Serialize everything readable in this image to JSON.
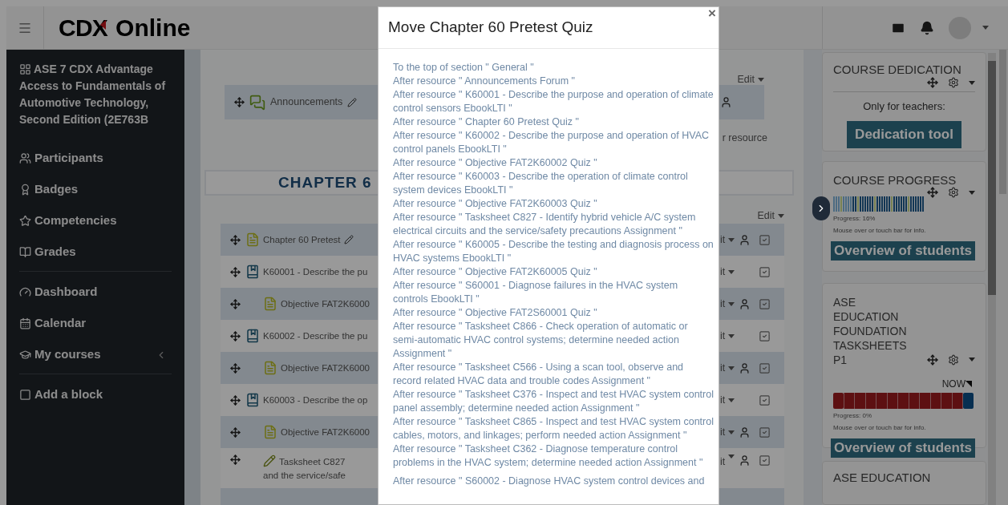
{
  "header": {
    "logo_main": "CDX",
    "logo_rest": "Online"
  },
  "sidebar": {
    "course_title": "ASE 7 CDX Advantage Access to Fundamentals of Automotive Technology, Second Edition (2E763B",
    "groups": [
      [
        {
          "label": "Participants",
          "chevron": false
        },
        {
          "label": "Badges",
          "chevron": false
        },
        {
          "label": "Competencies",
          "chevron": false
        },
        {
          "label": "Grades",
          "chevron": false
        }
      ],
      [
        {
          "label": "Dashboard",
          "chevron": false
        },
        {
          "label": "Calendar",
          "chevron": false
        },
        {
          "label": "My courses",
          "chevron": true
        }
      ],
      [
        {
          "label": "Add a block",
          "chevron": false
        }
      ]
    ]
  },
  "main": {
    "top_edit": "Edit",
    "announcements": "Announcements",
    "add_activity_partial": "r resource",
    "section_heading": "CHAPTER 6",
    "section_edit": "Edit",
    "rows": [
      {
        "kind": "quiz",
        "label": "Chapter 60 Pretest",
        "indented": false,
        "pencil": true,
        "user_icon": true,
        "edit": "it"
      },
      {
        "kind": "ebook",
        "label": "K60001 - Describe the pu",
        "indented": false,
        "pencil": false,
        "user_icon": false,
        "edit": "it"
      },
      {
        "kind": "quiz",
        "label": "Objective FAT2K6000",
        "indented": true,
        "pencil": false,
        "user_icon": true,
        "edit": "it"
      },
      {
        "kind": "ebook",
        "label": "K60002 - Describe the pu",
        "indented": false,
        "pencil": false,
        "user_icon": false,
        "edit": "it"
      },
      {
        "kind": "quiz",
        "label": "Objective FAT2K6000",
        "indented": true,
        "pencil": false,
        "user_icon": true,
        "edit": "it"
      },
      {
        "kind": "ebook",
        "label": "K60003 - Describe the op",
        "indented": false,
        "pencil": false,
        "user_icon": false,
        "edit": "it"
      },
      {
        "kind": "quiz",
        "label": "Objective FAT2K6000",
        "indented": true,
        "pencil": false,
        "user_icon": true,
        "edit": "it"
      },
      {
        "kind": "assignment",
        "label": "Tasksheet C827",
        "label_2": "and the service/safe",
        "indented": true,
        "pencil": false,
        "user_icon": true,
        "edit": "it"
      }
    ]
  },
  "modal": {
    "title": "Move Chapter 60 Pretest Quiz",
    "close": "×",
    "items": [
      "To the top of section \" General \"",
      "After resource \" Announcements Forum \"",
      "After resource \" K60001 - Describe the purpose and operation of climate control sensors EbookLTI \"",
      "After resource \" Chapter 60 Pretest Quiz \"",
      "After resource \" K60002 - Describe the purpose and operation of HVAC control panels EbookLTI \"",
      "After resource \" Objective FAT2K60002 Quiz \"",
      "After resource \" K60003 - Describe the operation of climate control system devices EbookLTI \"",
      "After resource \" Objective FAT2K60003 Quiz \"",
      "After resource \" Tasksheet C827 - Identify hybrid vehicle A/C system electrical circuits and the service/safety precautions Assignment \"",
      "After resource \" K60005 - Describe the testing and diagnosis process on HVAC systems EbookLTI \"",
      "After resource \" Objective FAT2K60005 Quiz \"",
      "After resource \" S60001 - Diagnose failures in the HVAC system controls EbookLTI \"",
      "After resource \" Objective FAT2S60001 Quiz \"",
      "After resource \" Tasksheet C866 - Check operation of automatic or semi-automatic HVAC control systems; determine needed action Assignment \"",
      "After resource \" Tasksheet C566 - Using a scan tool, observe and record related HVAC data and trouble codes Assignment \"",
      "After resource \" Tasksheet C376 - Inspect and test HVAC system control panel assembly; determine needed action Assignment \"",
      "After resource \" Tasksheet C865 - Inspect and test HVAC system control cables, motors, and linkages; perform needed action Assignment \"",
      "After resource \" Tasksheet C362 - Diagnose temperature control problems in the HVAC system; determine needed action Assignment \"",
      "After resource \" S60002 - Diagnose HVAC system control devices and"
    ]
  },
  "blocks": [
    {
      "kind": "dedication",
      "title": "COURSE DEDICATION",
      "note": "Only for teachers:",
      "button": "Dedication tool"
    },
    {
      "kind": "progress",
      "title": "COURSE PROGRESS",
      "progress": "Progress: 16%",
      "hint": "Mouse over or touch bar for info.",
      "button": "Overview of students"
    },
    {
      "kind": "segments",
      "title": "ASE EDUCATION FOUNDATION TASKSHEETS P1",
      "now": "NOW",
      "progress": "Progress: 0%",
      "hint": "Mouse over or touch bar for info.",
      "button": "Overview of students"
    },
    {
      "kind": "partial",
      "title": "ASE EDUCATION"
    }
  ]
}
